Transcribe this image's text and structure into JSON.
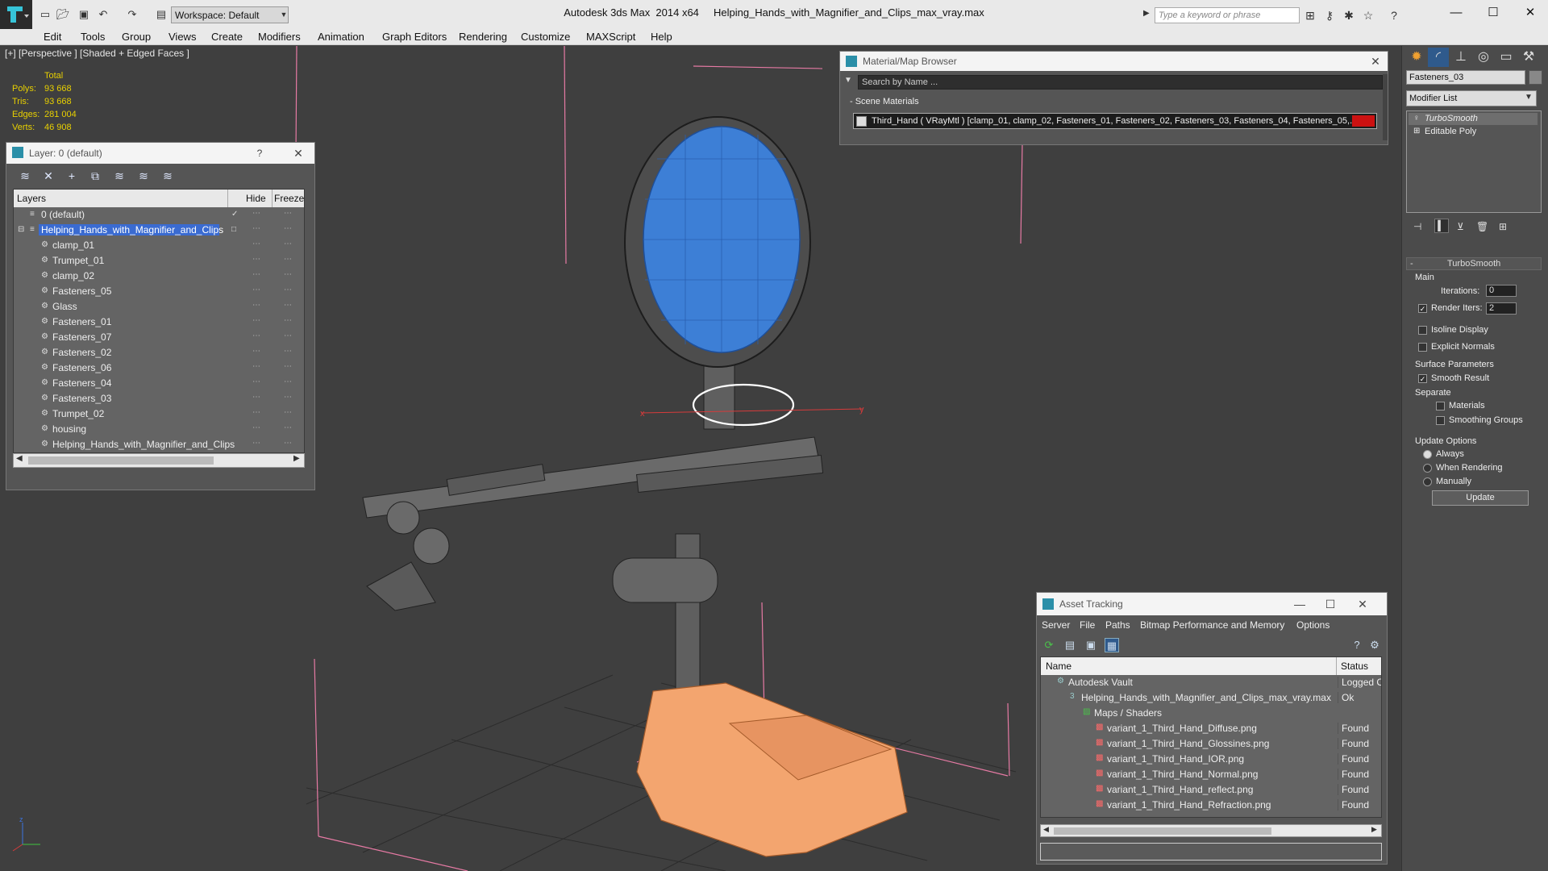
{
  "titlebar": {
    "app_title": "Autodesk 3ds Max  2014 x64",
    "file_title": "Helping_Hands_with_Magnifier_and_Clips_max_vray.max",
    "workspace": "Workspace: Default",
    "search_placeholder": "Type a keyword or phrase",
    "icons": [
      "logo-icon",
      "new-file-icon",
      "open-file-icon",
      "save-icon",
      "undo-icon",
      "redo-icon",
      "project-folder-icon",
      "binoculars-icon",
      "key-icon",
      "communication-icon",
      "star-icon",
      "help-icon"
    ],
    "window_buttons": [
      "minimize",
      "maximize",
      "close"
    ]
  },
  "menu": [
    "Edit",
    "Tools",
    "Group",
    "Views",
    "Create",
    "Modifiers",
    "Animation",
    "Graph Editors",
    "Rendering",
    "Customize",
    "MAXScript",
    "Help"
  ],
  "viewport": {
    "label": "[+] [Perspective ] [Shaded + Edged Faces ]",
    "stats": {
      "total_label": "Total",
      "rows": [
        {
          "label": "Polys:",
          "value": "93 668"
        },
        {
          "label": "Tris:",
          "value": "93 668"
        },
        {
          "label": "Edges:",
          "value": "281 004"
        },
        {
          "label": "Verts:",
          "value": "46 908"
        }
      ]
    },
    "gizmo_x": "x",
    "gizmo_y": "y",
    "axis_z": "z"
  },
  "layer_dialog": {
    "title": "Layer: 0 (default)",
    "help": "?",
    "close": "✕",
    "columns": {
      "layers": "Layers",
      "hide": "Hide",
      "freeze": "Freeze"
    },
    "rows": [
      {
        "name": "0 (default)",
        "level": 0,
        "active": true
      },
      {
        "name": "Helping_Hands_with_Magnifier_and_Clips",
        "level": 0,
        "selected": true
      },
      {
        "name": "clamp_01",
        "level": 1
      },
      {
        "name": "Trumpet_01",
        "level": 1
      },
      {
        "name": "clamp_02",
        "level": 1
      },
      {
        "name": "Fasteners_05",
        "level": 1
      },
      {
        "name": "Glass",
        "level": 1
      },
      {
        "name": "Fasteners_01",
        "level": 1
      },
      {
        "name": "Fasteners_07",
        "level": 1
      },
      {
        "name": "Fasteners_02",
        "level": 1
      },
      {
        "name": "Fasteners_06",
        "level": 1
      },
      {
        "name": "Fasteners_04",
        "level": 1
      },
      {
        "name": "Fasteners_03",
        "level": 1
      },
      {
        "name": "Trumpet_02",
        "level": 1
      },
      {
        "name": "housing",
        "level": 1
      },
      {
        "name": "Helping_Hands_with_Magnifier_and_Clips",
        "level": 1
      }
    ]
  },
  "material_browser": {
    "title": "Material/Map Browser",
    "search_placeholder": "Search by Name ...",
    "section": "- Scene Materials",
    "material": "Third_Hand  ( VRayMtl )  [clamp_01, clamp_02, Fasteners_01, Fasteners_02, Fasteners_03, Fasteners_04, Fasteners_05,...",
    "accent": "#cc1111"
  },
  "command_panel": {
    "object_name": "Fasteners_03",
    "modifier_list": "Modifier List",
    "stack": [
      {
        "name": "TurboSmooth",
        "italic": true,
        "active": true
      },
      {
        "name": "Editable Poly",
        "italic": false
      }
    ],
    "rollout_title": "TurboSmooth",
    "main_label": "Main",
    "iterations_label": "Iterations:",
    "iterations_value": "0",
    "render_iters_label": "Render Iters:",
    "render_iters_value": "2",
    "isoline_label": "Isoline Display",
    "explicit_normals_label": "Explicit Normals",
    "surface_params_label": "Surface Parameters",
    "smooth_result_label": "Smooth Result",
    "separate_label": "Separate",
    "materials_label": "Materials",
    "smoothing_groups_label": "Smoothing Groups",
    "update_options_label": "Update Options",
    "always_label": "Always",
    "when_rendering_label": "When Rendering",
    "manually_label": "Manually",
    "update_button": "Update"
  },
  "asset_tracking": {
    "title": "Asset Tracking",
    "menu": [
      "Server",
      "File",
      "Paths",
      "Bitmap Performance and Memory",
      "Options"
    ],
    "columns": {
      "name": "Name",
      "status": "Status"
    },
    "rows": [
      {
        "name": "Autodesk Vault",
        "status": "Logged O",
        "level": 0
      },
      {
        "name": "Helping_Hands_with_Magnifier_and_Clips_max_vray.max",
        "status": "Ok",
        "level": 1
      },
      {
        "name": "Maps / Shaders",
        "status": "",
        "level": 2
      },
      {
        "name": "variant_1_Third_Hand_Diffuse.png",
        "status": "Found",
        "level": 3
      },
      {
        "name": "variant_1_Third_Hand_Glossines.png",
        "status": "Found",
        "level": 3
      },
      {
        "name": "variant_1_Third_Hand_IOR.png",
        "status": "Found",
        "level": 3
      },
      {
        "name": "variant_1_Third_Hand_Normal.png",
        "status": "Found",
        "level": 3
      },
      {
        "name": "variant_1_Third_Hand_reflect.png",
        "status": "Found",
        "level": 3
      },
      {
        "name": "variant_1_Third_Hand_Refraction.png",
        "status": "Found",
        "level": 3
      }
    ]
  },
  "colors": {
    "selection": "#3a6bd1",
    "stat_yellow": "#e8d000",
    "lens": "#3d7fd6",
    "base": "#f3a56f"
  }
}
